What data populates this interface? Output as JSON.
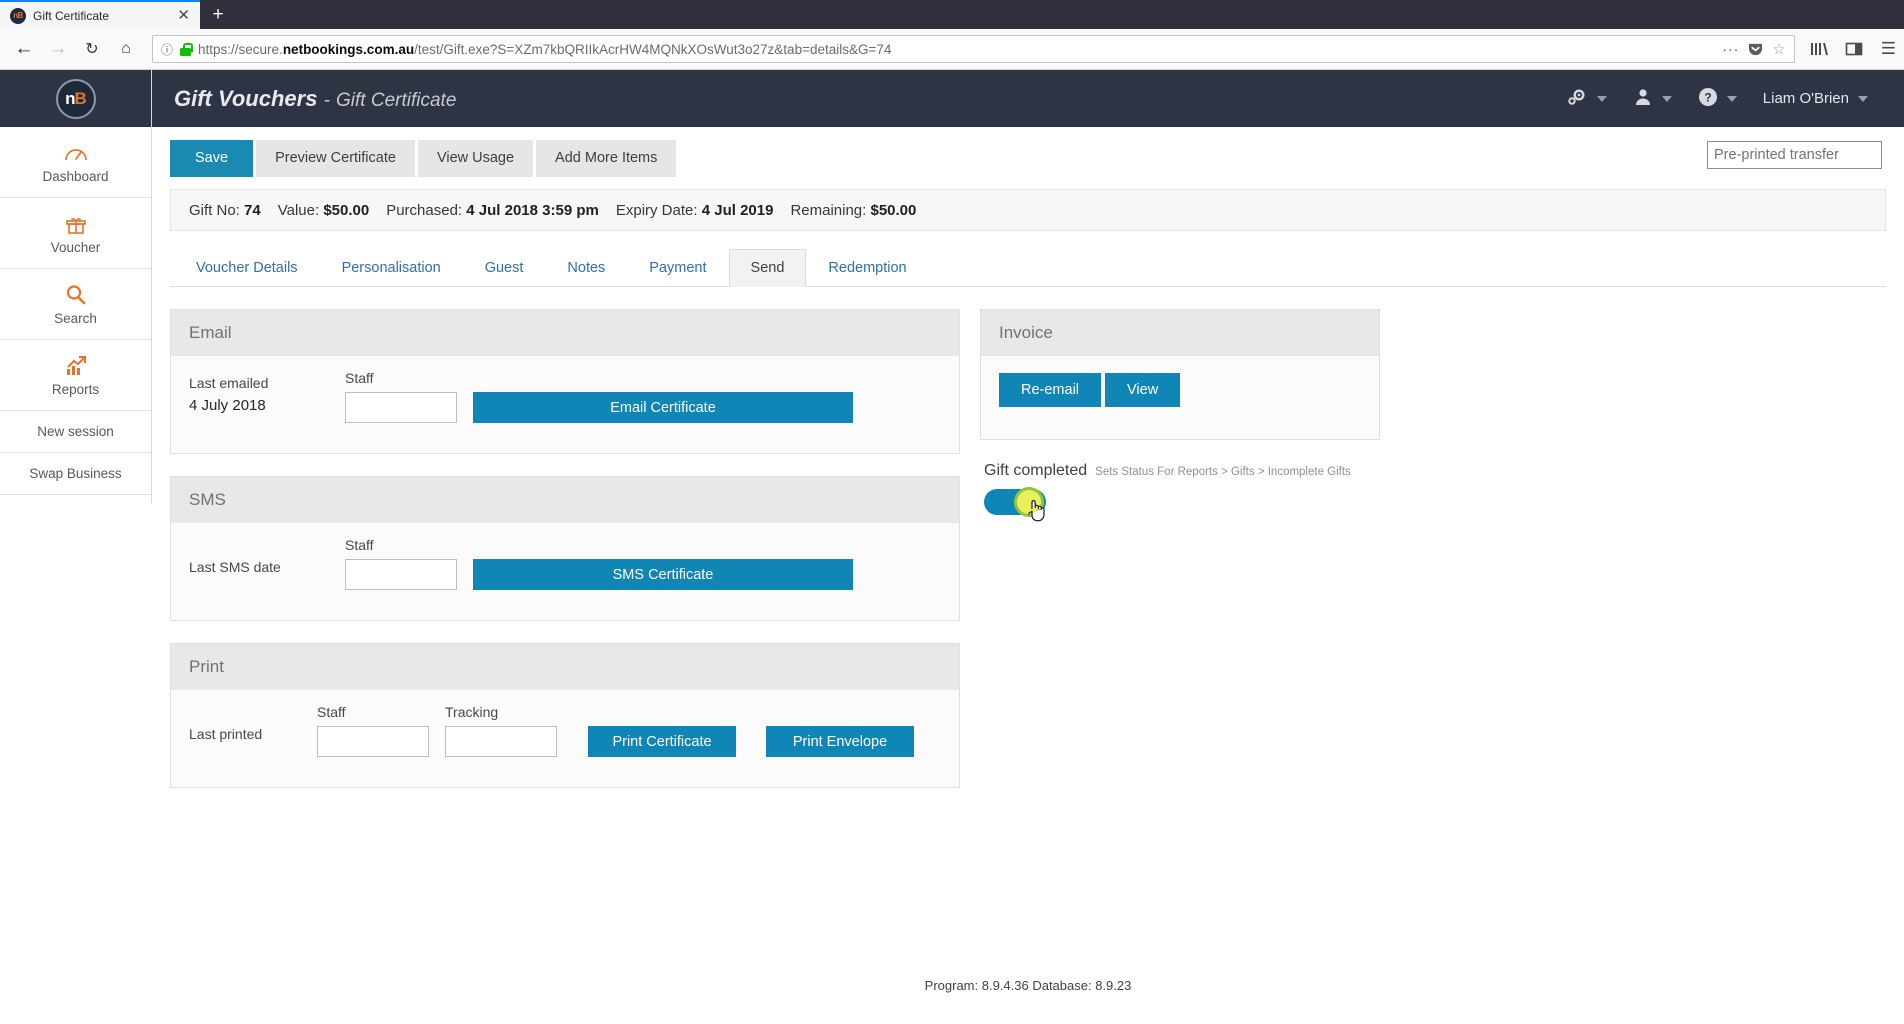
{
  "browser": {
    "tab": {
      "title": "Gift Certificate",
      "favicon": "nb-logo-icon",
      "close": "✕"
    },
    "new_tab": "+",
    "nav": {
      "back": "←",
      "forward": "→",
      "reload": "↻",
      "home": "⌂"
    },
    "url": {
      "scheme": "https://secure.",
      "domain": "netbookings.com.au",
      "path": "/test/Gift.exe?S=XZm7kbQRIIkAcrHW4MQNkXOsWut3o27z&tab=details&G=74",
      "info_icon": "ⓘ",
      "lock_icon": "lock-icon"
    },
    "actions": {
      "dots": "···",
      "pocket": "pocket-icon",
      "star": "☆",
      "library": "library-icon",
      "sidebar": "sidebar-icon",
      "menu": "☰"
    }
  },
  "sidebar": {
    "logo": {
      "n": "n",
      "b": "B"
    },
    "items": [
      {
        "label": "Dashboard",
        "icon": "☁"
      },
      {
        "label": "Voucher",
        "icon": "Ἰ1"
      },
      {
        "label": "Search",
        "icon": "⌕"
      },
      {
        "label": "Reports",
        "icon": "Ὄ8"
      }
    ],
    "text_items": [
      {
        "label": "New session"
      },
      {
        "label": "Swap Business"
      }
    ]
  },
  "header": {
    "title": "Gift Vouchers",
    "separator": "-",
    "subtitle": "Gift Certificate",
    "settings_icon": "gear-icon",
    "user_icon": "person-icon",
    "help_icon": "?",
    "username": "Liam O'Brien"
  },
  "toolbar": {
    "save": "Save",
    "preview": "Preview Certificate",
    "view_usage": "View Usage",
    "add_items": "Add More Items",
    "preprinted_placeholder": "Pre-printed transfer",
    "preprinted_value": ""
  },
  "info": {
    "gift_no_label": "Gift No:",
    "gift_no": "74",
    "value_label": "Value:",
    "value": "$50.00",
    "purchased_label": "Purchased:",
    "purchased": "4 Jul 2018 3:59 pm",
    "expiry_label": "Expiry Date:",
    "expiry": "4 Jul 2019",
    "remaining_label": "Remaining:",
    "remaining": "$50.00"
  },
  "tabs": [
    {
      "label": "Voucher Details",
      "active": false
    },
    {
      "label": "Personalisation",
      "active": false
    },
    {
      "label": "Guest",
      "active": false
    },
    {
      "label": "Notes",
      "active": false
    },
    {
      "label": "Payment",
      "active": false
    },
    {
      "label": "Send",
      "active": true
    },
    {
      "label": "Redemption",
      "active": false
    }
  ],
  "email_panel": {
    "title": "Email",
    "last_label": "Last emailed",
    "last_value": "4 July 2018",
    "staff_label": "Staff",
    "staff_value": "",
    "button": "Email Certificate"
  },
  "sms_panel": {
    "title": "SMS",
    "last_label": "Last SMS date",
    "last_value": "",
    "staff_label": "Staff",
    "staff_value": "",
    "button": "SMS Certificate"
  },
  "print_panel": {
    "title": "Print",
    "last_label": "Last printed",
    "last_value": "",
    "staff_label": "Staff",
    "staff_value": "",
    "tracking_label": "Tracking",
    "tracking_value": "",
    "print_certificate": "Print Certificate",
    "print_envelope": "Print Envelope"
  },
  "invoice_panel": {
    "title": "Invoice",
    "reemail": "Re-email",
    "view": "View"
  },
  "gift_completed": {
    "title": "Gift completed",
    "hint": "Sets Status For Reports > Gifts > Incomplete Gifts",
    "state": "on"
  },
  "footer": {
    "text": "Program: 8.9.4.36 Database: 8.9.23"
  },
  "colors": {
    "accent_blue": "#0f86b5",
    "save_blue": "#1b8ab3",
    "header_dark": "#2e3443",
    "sidebar_orange": "#e8722a",
    "link_blue": "#2f6fad",
    "toggle_on": "#0f86b5",
    "knob_yellow": "#ebf05a"
  }
}
